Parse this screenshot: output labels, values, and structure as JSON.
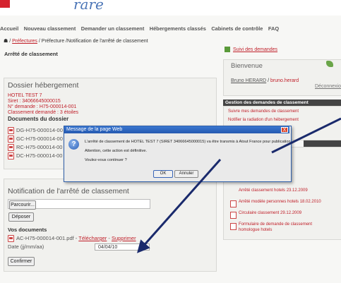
{
  "header": {
    "logo_text": "rare"
  },
  "nav": {
    "items": [
      "Accueil",
      "Nouveau classement",
      "Demander un classement",
      "Hébergements classés",
      "Cabinets de contrôle",
      "FAQ"
    ]
  },
  "breadcrumb": {
    "home_icon": "home-icon",
    "part1": "Préfectures",
    "sep": "/",
    "part2": "Préfecture",
    "part3": "/Notification de l'arrêté de classement"
  },
  "page_title": "Arrêté de classement",
  "dossier": {
    "title": "Dossier hébergement",
    "hotel": "HOTEL TEST 7",
    "siret": "Siret : 34066645000015",
    "demande": "N° demande : H75-000014-001",
    "classement": "Classement demandé : 3 étoiles",
    "docs_title": "Documents du dossier",
    "documents": [
      "DG-H75-000014-00",
      "GC-H75-000014-00",
      "RC-H75-000014-00",
      "DC-H75-000014-00"
    ]
  },
  "notification": {
    "title": "Notification de l'arrêté de classement",
    "parcourir": "Parcourir...",
    "deposer": "Déposer",
    "vos_documents": "Vos documents",
    "doc_name": "AC-H75-000014-001.pdf -",
    "telecharger": "Télécharger",
    "dash": "-",
    "supprimer": "Supprimer",
    "date_label": "Date (jj/mm/aa)",
    "date_value": "04/04/10",
    "confirmer": "Confirmer"
  },
  "sidebar": {
    "suivi": "Suivi des demandes",
    "bienvenue": "Bienvenue",
    "user": "Bruno HERARD",
    "sep": "/",
    "username": "bruno.herard",
    "deconnexion": "Déconnexion",
    "gestion_header": "Gestion des demandes de classement",
    "gestion_links": [
      "Suivre mes demandes de classement",
      "Notifier la radiation d'un hébergement"
    ],
    "docs": [
      "Arrêté classement hotels 23.12.2009",
      "Arrêté modèle personnes hotels 18.02.2010",
      "Circulaire classement 29.12.2009",
      "Formulaire de demande de classement",
      "homologue hotels"
    ]
  },
  "dialog": {
    "title": "Message de la page Web",
    "close": "X",
    "line1": "L'arrêté de classement de HOTEL TEST 7 (SIRET 34066645000015) va être transmis à Atout France pour publication.",
    "line2": "Attention, cette action est définitive.",
    "line3": "Voulez-vous continuer ?",
    "ok": "OK",
    "annuler": "Annuler",
    "icon": "question-icon"
  },
  "colors": {
    "accent_red": "#c0202a",
    "dialog_blue": "#2558b0",
    "arrow_navy": "#1a2a6c"
  }
}
